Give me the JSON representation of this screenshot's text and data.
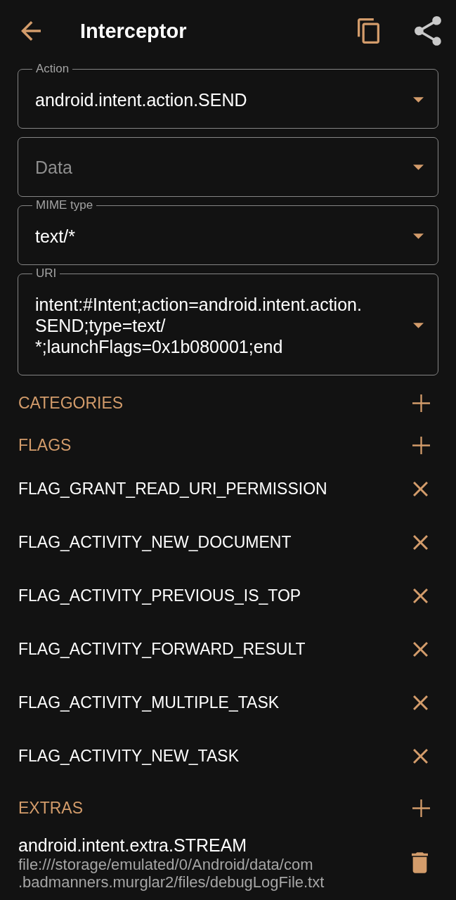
{
  "app_bar": {
    "title": "Interceptor"
  },
  "fields": [
    {
      "label": "Action",
      "value_lines": [
        "android.intent.action.SEND"
      ]
    },
    {
      "placeholder": "Data"
    },
    {
      "label": "MIME type",
      "value_lines": [
        "text/*"
      ]
    },
    {
      "label": "URI",
      "value_lines": [
        "intent:#Intent;action=android.intent.action.",
        "SEND;type=text/",
        "*;launchFlags=0x1b080001;end"
      ]
    }
  ],
  "categories": {
    "heading": "CATEGORIES"
  },
  "flags": {
    "heading": "FLAGS",
    "items": [
      "FLAG_GRANT_READ_URI_PERMISSION",
      "FLAG_ACTIVITY_NEW_DOCUMENT",
      "FLAG_ACTIVITY_PREVIOUS_IS_TOP",
      "FLAG_ACTIVITY_FORWARD_RESULT",
      "FLAG_ACTIVITY_MULTIPLE_TASK",
      "FLAG_ACTIVITY_NEW_TASK"
    ]
  },
  "extras": {
    "heading": "EXTRAS",
    "items": [
      {
        "name": "android.intent.extra.STREAM",
        "value_lines": [
          "file:///storage/emulated/0/Android/data/com",
          ".badmanners.murglar2/files/debugLogFile.txt"
        ]
      }
    ]
  }
}
